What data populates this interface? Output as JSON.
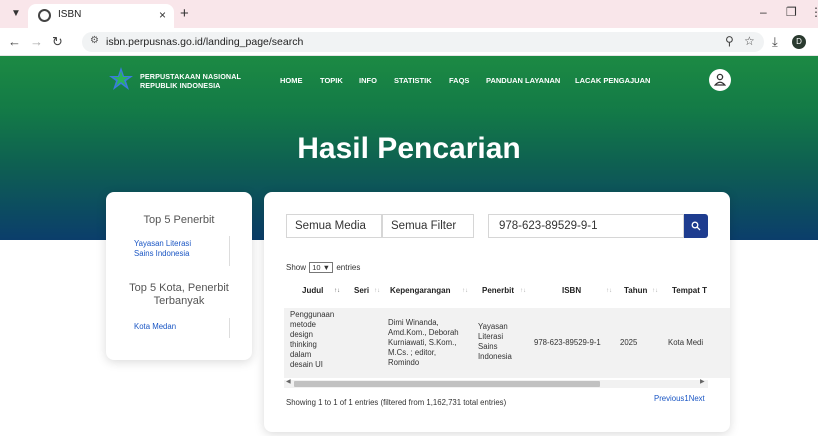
{
  "browser": {
    "tab_title": "ISBN",
    "url": "isbn.perpusnas.go.id/landing_page/search",
    "profile_initial": "D"
  },
  "site": {
    "brand_line1": "PERPUSTAKAAN NASIONAL",
    "brand_line2": "REPUBLIK INDONESIA",
    "nav": [
      "HOME",
      "TOPIK",
      "INFO",
      "STATISTIK",
      "FAQS",
      "PANDUAN LAYANAN",
      "LACAK PENGAJUAN"
    ],
    "colors": {
      "hero_top": "#1c8a43",
      "hero_bottom": "#0b3e6b",
      "accent": "#1e3c8f",
      "link": "#1a56c4"
    }
  },
  "hero": {
    "title": "Hasil Pencarian"
  },
  "sidebar": {
    "publisher_title": "Top 5 Penerbit",
    "publisher_item_l1": "Yayasan Literasi",
    "publisher_item_l2": "Sains Indonesia",
    "city_title_l1": "Top 5 Kota, Penerbit",
    "city_title_l2": "Terbanyak",
    "city_item": "Kota Medan"
  },
  "search": {
    "media": "Semua Media",
    "filter": "Semua Filter",
    "query": "978-623-89529-9-1"
  },
  "table": {
    "show_label": "Show",
    "entries_value": "10",
    "entries_label": "entries",
    "headers": [
      "Judul",
      "Seri",
      "Kepengarangan",
      "Penerbit",
      "ISBN",
      "Tahun",
      "Tempat T"
    ],
    "row": {
      "judul": [
        "Penggunaan",
        "metode",
        "design",
        "thinking",
        "dalam",
        "desain UI"
      ],
      "seri": "",
      "kepengarangan": [
        "Dimi Winanda,",
        "Amd.Kom., Deborah",
        "Kurniawati, S.Kom.,",
        "M.Cs. ; editor,",
        "Romindo"
      ],
      "penerbit": [
        "Yayasan",
        "Literasi",
        "Sains",
        "Indonesia"
      ],
      "isbn": "978-623-89529-9-1",
      "tahun": "2025",
      "tempat": "Kota Medi"
    },
    "info": "Showing 1 to 1 of 1 entries (filtered from 1,162,731 total entries)",
    "pager": {
      "previous": "Previous",
      "page": "1",
      "next": "Next"
    }
  }
}
